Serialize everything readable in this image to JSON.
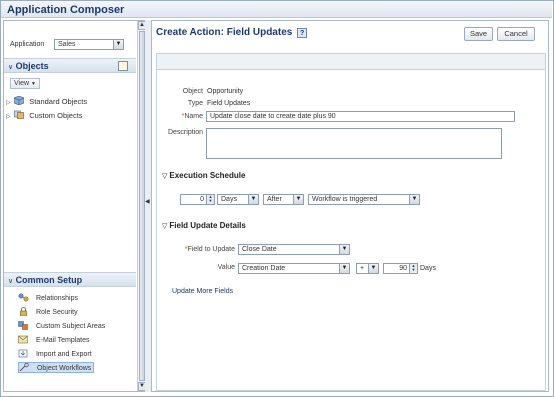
{
  "app": {
    "title": "Application Composer"
  },
  "sidebar": {
    "application_label": "Application",
    "application_value": "Sales",
    "objects_header": "Objects",
    "view_label": "View",
    "tree": [
      {
        "label": "Standard Objects",
        "icon": "cube-icon"
      },
      {
        "label": "Custom Objects",
        "icon": "custom-objects-icon"
      }
    ],
    "common_setup_header": "Common Setup",
    "common_items": [
      {
        "label": "Relationships",
        "icon": "relationships-icon"
      },
      {
        "label": "Role Security",
        "icon": "lock-icon"
      },
      {
        "label": "Custom Subject Areas",
        "icon": "subject-areas-icon"
      },
      {
        "label": "E-Mail Templates",
        "icon": "email-icon"
      },
      {
        "label": "Import and Export",
        "icon": "import-export-icon"
      },
      {
        "label": "Object Workflows",
        "icon": "workflow-icon",
        "selected": true
      }
    ]
  },
  "main": {
    "title": "Create Action: Field Updates",
    "help": "?",
    "save_label": "Save",
    "cancel_label": "Cancel",
    "object_label": "Object",
    "object_value": "Opportunity",
    "type_label": "Type",
    "type_value": "Field Updates",
    "name_label": "Name",
    "name_value": "Update close date to create date plus 90",
    "description_label": "Description",
    "description_value": "",
    "execution_header": "Execution Schedule",
    "exec_number": "0",
    "exec_unit": "Days",
    "exec_when": "After",
    "exec_event": "Workflow is triggered",
    "field_update_header": "Field Update Details",
    "field_to_update_label": "Field to Update",
    "field_to_update_value": "Close Date",
    "value_label": "Value",
    "value_field": "Creation Date",
    "value_operator": "+",
    "value_number": "90",
    "value_unit": "Days",
    "update_more_fields": "Update More Fields"
  }
}
